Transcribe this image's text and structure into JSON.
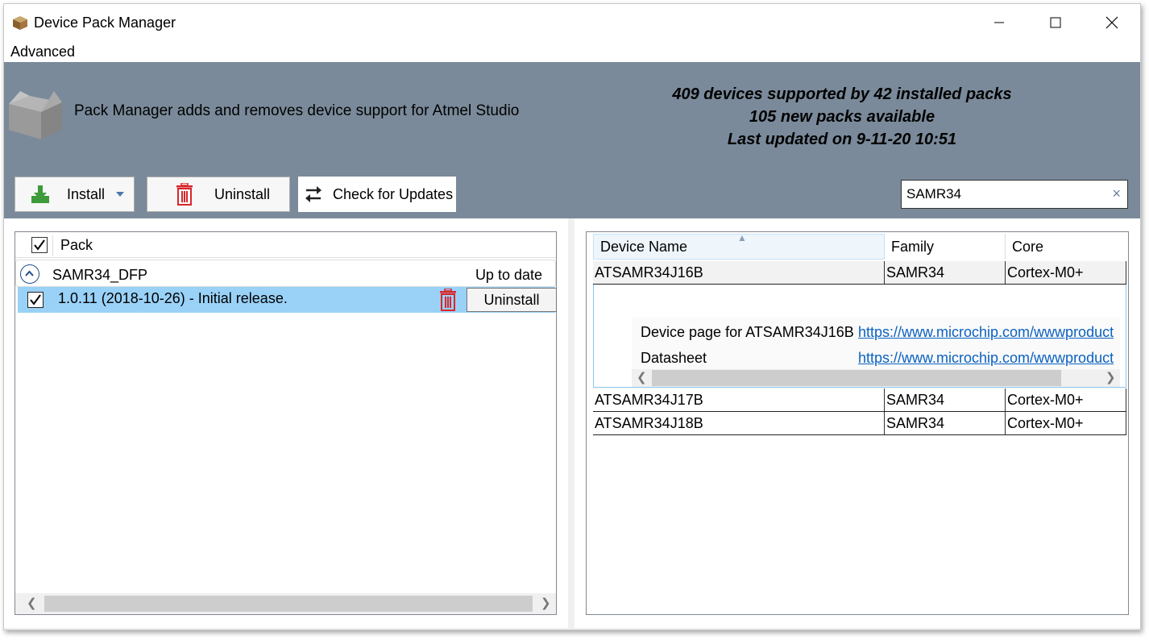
{
  "window": {
    "title": "Device Pack Manager"
  },
  "menu": {
    "items": [
      "Advanced"
    ]
  },
  "header": {
    "description": "Pack Manager adds and removes device support for Atmel Studio",
    "stats": [
      "409 devices supported by 42 installed packs",
      "105 new packs available",
      "Last updated on 9-11-20 10:51"
    ]
  },
  "toolbar": {
    "install_label": "Install",
    "uninstall_label": "Uninstall",
    "check_updates_label": "Check for Updates"
  },
  "search": {
    "value": "SAMR34",
    "clear_icon": "×"
  },
  "packs": {
    "header_label": "Pack",
    "group": {
      "name": "SAMR34_DFP",
      "status": "Up to date"
    },
    "versions": [
      {
        "text": "1.0.11 (2018-10-26) - Initial release.",
        "checked": true,
        "action_label": "Uninstall"
      }
    ]
  },
  "devices": {
    "columns": [
      "Device Name",
      "Family",
      "Core"
    ],
    "rows": [
      {
        "name": "ATSAMR34J16B",
        "family": "SAMR34",
        "core": "Cortex-M0+"
      },
      {
        "name": "ATSAMR34J17B",
        "family": "SAMR34",
        "core": "Cortex-M0+"
      },
      {
        "name": "ATSAMR34J18B",
        "family": "SAMR34",
        "core": "Cortex-M0+"
      }
    ],
    "details": [
      {
        "label": "Device page for ATSAMR34J16B",
        "link": "https://www.microchip.com/wwwproduct"
      },
      {
        "label": "Datasheet",
        "link": "https://www.microchip.com/wwwproduct"
      }
    ]
  },
  "colors": {
    "header_band": "#7a8a9a",
    "selected_row": "#99d1f7",
    "link": "#0b61c1",
    "trash": "#d9262b"
  }
}
